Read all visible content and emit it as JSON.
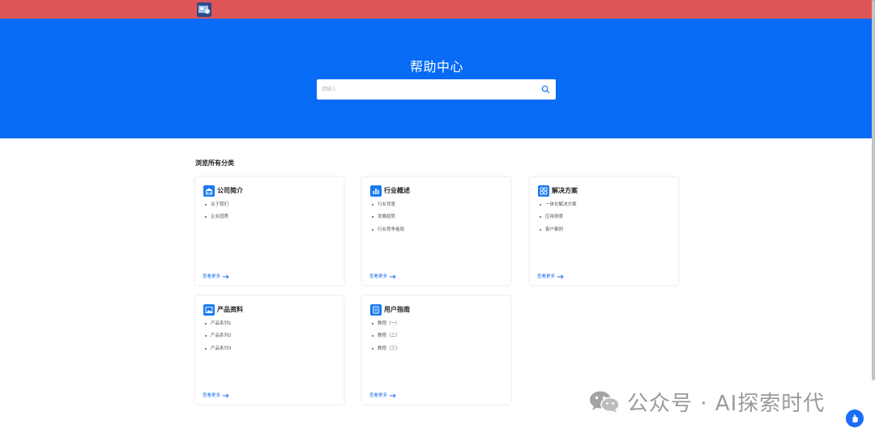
{
  "header": {
    "logo_icon": "site-logo-icon",
    "brand_color": "#de5555"
  },
  "hero": {
    "title": "帮助中心",
    "background": "#076bf6",
    "search": {
      "placeholder": "请输入",
      "value": "",
      "icon": "search-icon"
    }
  },
  "section": {
    "title": "浏览所有分类"
  },
  "categories": [
    {
      "title": "公司简介",
      "icon": "building-icon",
      "items": [
        "关于我们",
        "企业团质"
      ],
      "more_label": "查看更多"
    },
    {
      "title": "行业概述",
      "icon": "bar-chart-icon",
      "items": [
        "行业背景",
        "发展趋势",
        "行业竞争格局"
      ],
      "more_label": "查看更多"
    },
    {
      "title": "解决方案",
      "icon": "grid-icon",
      "items": [
        "一体化解决方案",
        "应用场景",
        "客户案例"
      ],
      "more_label": "查看更多"
    },
    {
      "title": "产品资料",
      "icon": "image-icon",
      "items": [
        "产品系列1",
        "产品系列2",
        "产品系列3"
      ],
      "more_label": "查看更多"
    },
    {
      "title": "用户指南",
      "icon": "document-icon",
      "items": [
        "教程（一）",
        "教程（二）",
        "教程（三）"
      ],
      "more_label": "查看更多"
    }
  ],
  "watermark": {
    "icon": "wechat-icon",
    "text": "公众号 · AI探索时代"
  },
  "floating_button": {
    "icon": "hand-icon"
  }
}
